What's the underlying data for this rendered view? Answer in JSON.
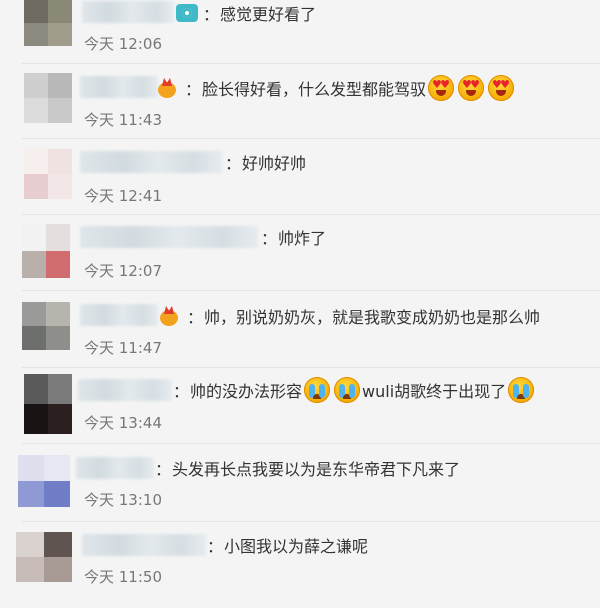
{
  "comments": [
    {
      "text": "感觉更好看了",
      "time": "今天 12:06",
      "avatar_colors": [
        "#6f6b60",
        "#8a8877",
        "#8c8a7e",
        "#a09c8c"
      ]
    },
    {
      "text": "脸长得好看，什么发型都能驾驭",
      "time": "今天 11:43",
      "avatar_colors": [
        "#cfcfcf",
        "#b9b9b9",
        "#dcdcdc",
        "#c9c9c9"
      ]
    },
    {
      "text": "好帅好帅",
      "time": "今天 12:41",
      "avatar_colors": [
        "#f7eeee",
        "#f1e2e2",
        "#e7cdd0",
        "#f3e6e6"
      ]
    },
    {
      "text": "帅炸了",
      "time": "今天 12:07",
      "avatar_colors": [
        "#f2f2f2",
        "#e4dede",
        "#b9b0ab",
        "#d16c6f"
      ]
    },
    {
      "text": "帅，别说奶奶灰，就是我歌变成奶奶也是那么帅",
      "time": "今天 11:47",
      "avatar_colors": [
        "#9a9a98",
        "#b6b4ad",
        "#6d6f6c",
        "#8e8f8b"
      ]
    },
    {
      "text_parts": [
        "帅的没办法形容",
        "wuli胡歌终于出现了"
      ],
      "time": "今天 13:44",
      "avatar_colors": [
        "#5a5a5a",
        "#7a7a7a",
        "#1a1313",
        "#2b1f1f"
      ]
    },
    {
      "text": "头发再长点我要以为是东华帝君下凡来了",
      "time": "今天 13:10",
      "avatar_colors": [
        "#dfe0ef",
        "#e6e7f2",
        "#8f9ad4",
        "#6f7ec7"
      ]
    },
    {
      "text": "小图我以为薛之谦呢",
      "time": "今天 11:50",
      "avatar_colors": [
        "#d9d2cf",
        "#5f5450",
        "#c8bcb8",
        "#a89b96"
      ]
    }
  ],
  "colon": "：",
  "icons": {
    "camera": "camera-icon",
    "vip": "vip-crown-icon",
    "heart_eyes": "heart-eyes-emoji",
    "cry": "crying-emoji"
  },
  "colors": {
    "background": "#f4f4f4",
    "time_text": "#777777",
    "body_text": "#333333"
  }
}
